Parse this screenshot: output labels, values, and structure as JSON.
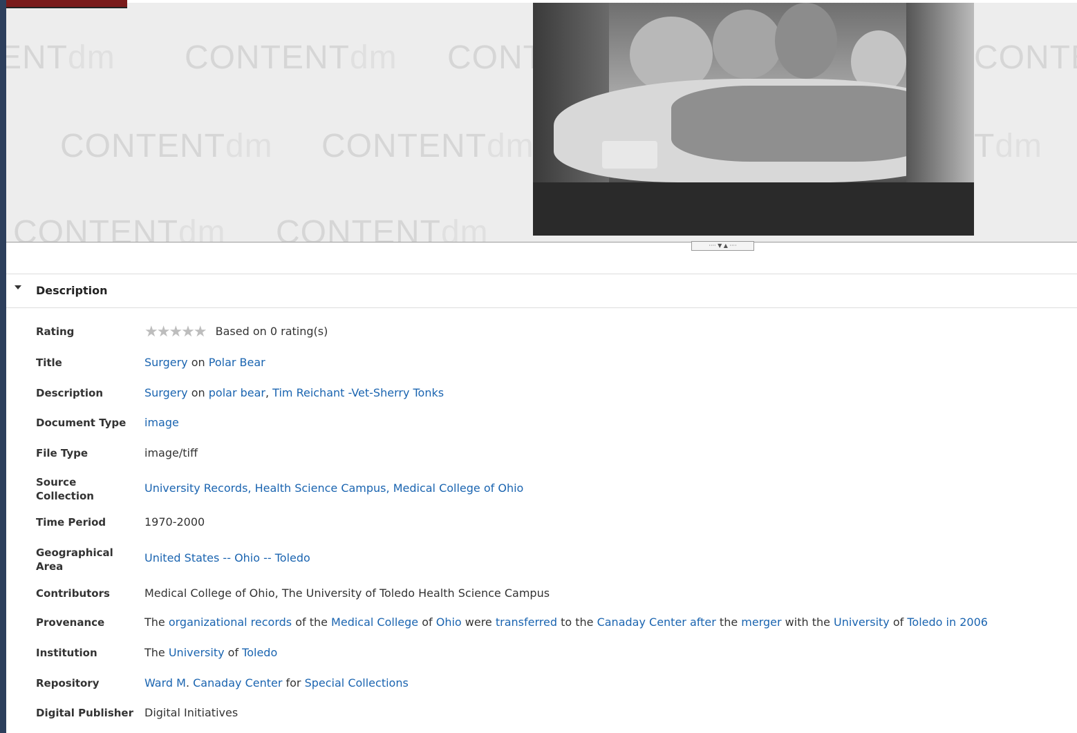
{
  "viewer": {
    "watermark_text": "CONTENT",
    "watermark_suffix": "dm",
    "image_alt": "Surgery on polar bear photograph"
  },
  "description": {
    "section_title": "Description",
    "fields": {
      "rating": {
        "label": "Rating",
        "stars": 5,
        "filled": 0,
        "text": "Based on 0 rating(s)"
      },
      "title": {
        "label": "Title",
        "parts": [
          "Surgery",
          " on ",
          "Polar Bear"
        ]
      },
      "description": {
        "label": "Description",
        "parts": [
          "Surgery",
          " on ",
          "polar bear",
          ", ",
          "Tim Reichant -Vet-Sherry Tonks"
        ]
      },
      "document_type": {
        "label": "Document Type",
        "value": "image"
      },
      "file_type": {
        "label": "File Type",
        "value": "image/tiff"
      },
      "source_collection": {
        "label": "Source Collection",
        "value": "University Records, Health Science Campus, Medical College of Ohio"
      },
      "time_period": {
        "label": "Time Period",
        "value": "1970-2000"
      },
      "geographical_area": {
        "label": "Geographical Area",
        "value": "United States -- Ohio -- Toledo"
      },
      "contributors": {
        "label": "Contributors",
        "value": "Medical College of Ohio, The University of Toledo Health Science Campus"
      },
      "provenance": {
        "label": "Provenance",
        "parts": [
          "The ",
          "organizational records",
          " of the ",
          "Medical College",
          " of ",
          "Ohio",
          " were ",
          "transferred",
          " to the ",
          "Canaday Center",
          " ",
          "after",
          " the ",
          "merger",
          " with the ",
          "University",
          " of ",
          "Toledo",
          " ",
          "in",
          " ",
          "2006"
        ]
      },
      "institution": {
        "label": "Institution",
        "parts": [
          "The ",
          "University",
          " of ",
          "Toledo"
        ]
      },
      "repository": {
        "label": "Repository",
        "parts": [
          "Ward M",
          ". ",
          "Canaday Center",
          " for ",
          "Special Collections"
        ]
      },
      "digital_publisher": {
        "label": "Digital Publisher",
        "value": "Digital Initiatives"
      }
    }
  },
  "colors": {
    "link": "#1a64b0",
    "label": "#333333",
    "page_bg": "#2d3f5c"
  }
}
